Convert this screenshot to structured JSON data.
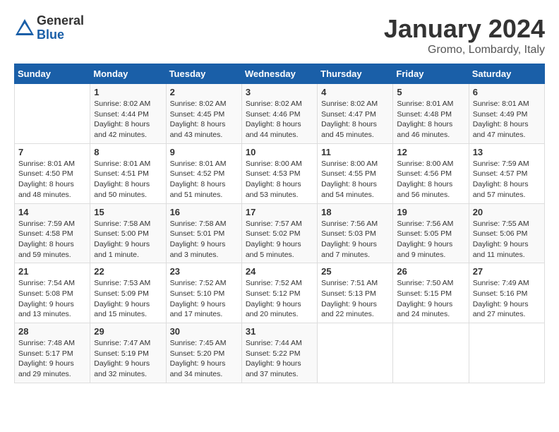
{
  "logo": {
    "general": "General",
    "blue": "Blue"
  },
  "title": "January 2024",
  "location": "Gromo, Lombardy, Italy",
  "weekdays": [
    "Sunday",
    "Monday",
    "Tuesday",
    "Wednesday",
    "Thursday",
    "Friday",
    "Saturday"
  ],
  "weeks": [
    [
      {
        "day": "",
        "sunrise": "",
        "sunset": "",
        "daylight": ""
      },
      {
        "day": "1",
        "sunrise": "Sunrise: 8:02 AM",
        "sunset": "Sunset: 4:44 PM",
        "daylight": "Daylight: 8 hours and 42 minutes."
      },
      {
        "day": "2",
        "sunrise": "Sunrise: 8:02 AM",
        "sunset": "Sunset: 4:45 PM",
        "daylight": "Daylight: 8 hours and 43 minutes."
      },
      {
        "day": "3",
        "sunrise": "Sunrise: 8:02 AM",
        "sunset": "Sunset: 4:46 PM",
        "daylight": "Daylight: 8 hours and 44 minutes."
      },
      {
        "day": "4",
        "sunrise": "Sunrise: 8:02 AM",
        "sunset": "Sunset: 4:47 PM",
        "daylight": "Daylight: 8 hours and 45 minutes."
      },
      {
        "day": "5",
        "sunrise": "Sunrise: 8:01 AM",
        "sunset": "Sunset: 4:48 PM",
        "daylight": "Daylight: 8 hours and 46 minutes."
      },
      {
        "day": "6",
        "sunrise": "Sunrise: 8:01 AM",
        "sunset": "Sunset: 4:49 PM",
        "daylight": "Daylight: 8 hours and 47 minutes."
      }
    ],
    [
      {
        "day": "7",
        "sunrise": "Sunrise: 8:01 AM",
        "sunset": "Sunset: 4:50 PM",
        "daylight": "Daylight: 8 hours and 48 minutes."
      },
      {
        "day": "8",
        "sunrise": "Sunrise: 8:01 AM",
        "sunset": "Sunset: 4:51 PM",
        "daylight": "Daylight: 8 hours and 50 minutes."
      },
      {
        "day": "9",
        "sunrise": "Sunrise: 8:01 AM",
        "sunset": "Sunset: 4:52 PM",
        "daylight": "Daylight: 8 hours and 51 minutes."
      },
      {
        "day": "10",
        "sunrise": "Sunrise: 8:00 AM",
        "sunset": "Sunset: 4:53 PM",
        "daylight": "Daylight: 8 hours and 53 minutes."
      },
      {
        "day": "11",
        "sunrise": "Sunrise: 8:00 AM",
        "sunset": "Sunset: 4:55 PM",
        "daylight": "Daylight: 8 hours and 54 minutes."
      },
      {
        "day": "12",
        "sunrise": "Sunrise: 8:00 AM",
        "sunset": "Sunset: 4:56 PM",
        "daylight": "Daylight: 8 hours and 56 minutes."
      },
      {
        "day": "13",
        "sunrise": "Sunrise: 7:59 AM",
        "sunset": "Sunset: 4:57 PM",
        "daylight": "Daylight: 8 hours and 57 minutes."
      }
    ],
    [
      {
        "day": "14",
        "sunrise": "Sunrise: 7:59 AM",
        "sunset": "Sunset: 4:58 PM",
        "daylight": "Daylight: 8 hours and 59 minutes."
      },
      {
        "day": "15",
        "sunrise": "Sunrise: 7:58 AM",
        "sunset": "Sunset: 5:00 PM",
        "daylight": "Daylight: 9 hours and 1 minute."
      },
      {
        "day": "16",
        "sunrise": "Sunrise: 7:58 AM",
        "sunset": "Sunset: 5:01 PM",
        "daylight": "Daylight: 9 hours and 3 minutes."
      },
      {
        "day": "17",
        "sunrise": "Sunrise: 7:57 AM",
        "sunset": "Sunset: 5:02 PM",
        "daylight": "Daylight: 9 hours and 5 minutes."
      },
      {
        "day": "18",
        "sunrise": "Sunrise: 7:56 AM",
        "sunset": "Sunset: 5:03 PM",
        "daylight": "Daylight: 9 hours and 7 minutes."
      },
      {
        "day": "19",
        "sunrise": "Sunrise: 7:56 AM",
        "sunset": "Sunset: 5:05 PM",
        "daylight": "Daylight: 9 hours and 9 minutes."
      },
      {
        "day": "20",
        "sunrise": "Sunrise: 7:55 AM",
        "sunset": "Sunset: 5:06 PM",
        "daylight": "Daylight: 9 hours and 11 minutes."
      }
    ],
    [
      {
        "day": "21",
        "sunrise": "Sunrise: 7:54 AM",
        "sunset": "Sunset: 5:08 PM",
        "daylight": "Daylight: 9 hours and 13 minutes."
      },
      {
        "day": "22",
        "sunrise": "Sunrise: 7:53 AM",
        "sunset": "Sunset: 5:09 PM",
        "daylight": "Daylight: 9 hours and 15 minutes."
      },
      {
        "day": "23",
        "sunrise": "Sunrise: 7:52 AM",
        "sunset": "Sunset: 5:10 PM",
        "daylight": "Daylight: 9 hours and 17 minutes."
      },
      {
        "day": "24",
        "sunrise": "Sunrise: 7:52 AM",
        "sunset": "Sunset: 5:12 PM",
        "daylight": "Daylight: 9 hours and 20 minutes."
      },
      {
        "day": "25",
        "sunrise": "Sunrise: 7:51 AM",
        "sunset": "Sunset: 5:13 PM",
        "daylight": "Daylight: 9 hours and 22 minutes."
      },
      {
        "day": "26",
        "sunrise": "Sunrise: 7:50 AM",
        "sunset": "Sunset: 5:15 PM",
        "daylight": "Daylight: 9 hours and 24 minutes."
      },
      {
        "day": "27",
        "sunrise": "Sunrise: 7:49 AM",
        "sunset": "Sunset: 5:16 PM",
        "daylight": "Daylight: 9 hours and 27 minutes."
      }
    ],
    [
      {
        "day": "28",
        "sunrise": "Sunrise: 7:48 AM",
        "sunset": "Sunset: 5:17 PM",
        "daylight": "Daylight: 9 hours and 29 minutes."
      },
      {
        "day": "29",
        "sunrise": "Sunrise: 7:47 AM",
        "sunset": "Sunset: 5:19 PM",
        "daylight": "Daylight: 9 hours and 32 minutes."
      },
      {
        "day": "30",
        "sunrise": "Sunrise: 7:45 AM",
        "sunset": "Sunset: 5:20 PM",
        "daylight": "Daylight: 9 hours and 34 minutes."
      },
      {
        "day": "31",
        "sunrise": "Sunrise: 7:44 AM",
        "sunset": "Sunset: 5:22 PM",
        "daylight": "Daylight: 9 hours and 37 minutes."
      },
      {
        "day": "",
        "sunrise": "",
        "sunset": "",
        "daylight": ""
      },
      {
        "day": "",
        "sunrise": "",
        "sunset": "",
        "daylight": ""
      },
      {
        "day": "",
        "sunrise": "",
        "sunset": "",
        "daylight": ""
      }
    ]
  ]
}
